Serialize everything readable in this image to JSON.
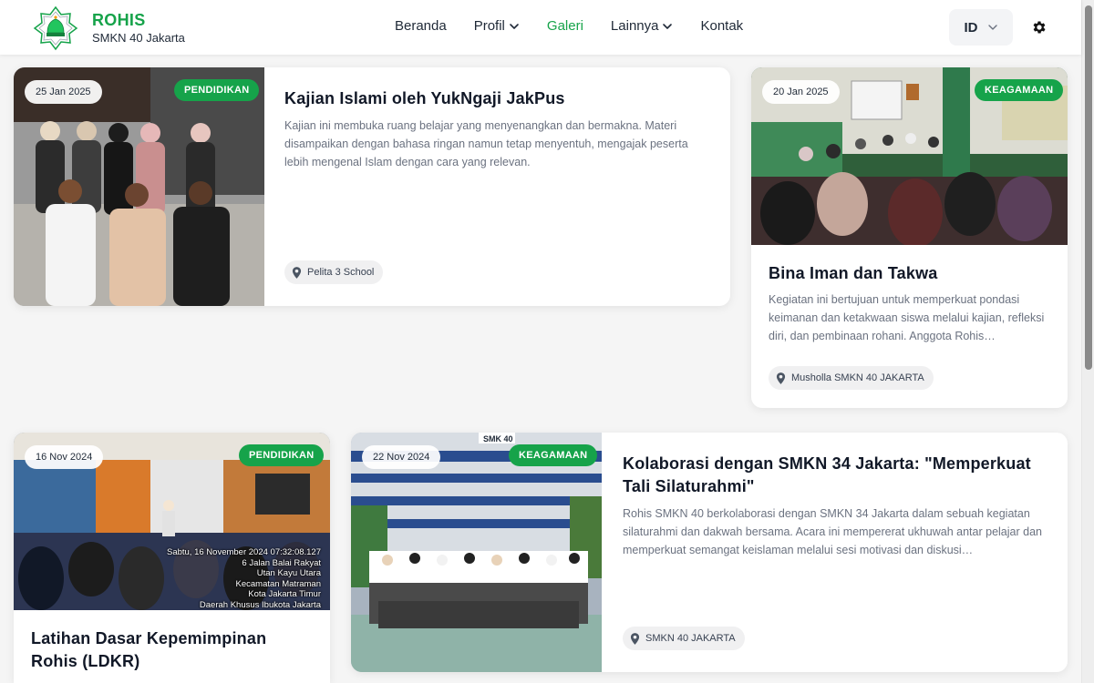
{
  "brand": {
    "title": "ROHIS",
    "subtitle": "SMKN 40 Jakarta"
  },
  "nav": {
    "beranda": "Beranda",
    "profil": "Profil",
    "galeri": "Galeri",
    "lainnya": "Lainnya",
    "kontak": "Kontak",
    "active": "Galeri"
  },
  "language": {
    "selected": "ID"
  },
  "colors": {
    "accent": "#16a34a",
    "background": "#f5f5f5"
  },
  "icons": [
    "chevron-down-icon",
    "gear-icon",
    "map-pin-icon"
  ],
  "gallery": [
    {
      "date": "25 Jan 2025",
      "category": "PENDIDIKAN",
      "title": "Kajian Islami oleh YukNgaji JakPus",
      "description": "Kajian ini membuka ruang belajar yang menyenangkan dan bermakna. Materi disampaikan dengan bahasa ringan namun tetap menyentuh, mengajak peserta lebih mengenal Islam dengan cara yang relevan.",
      "location": "Pelita 3 School"
    },
    {
      "date": "20 Jan 2025",
      "category": "KEAGAMAAN",
      "title": "Bina Iman dan Takwa",
      "description": "Kegiatan ini bertujuan untuk memperkuat pondasi keimanan dan ketakwaan siswa melalui kajian, refleksi diri, dan pembinaan rohani. Anggota Rohis…",
      "location": "Musholla SMKN 40 JAKARTA"
    },
    {
      "date": "16 Nov 2024",
      "category": "PENDIDIKAN",
      "title": "Latihan Dasar Kepemimpinan Rohis (LDKR)",
      "photo_stamp": [
        "Sabtu, 16 November 2024 07:32:08.127",
        "6 Jalan Balai Rakyat",
        "Utan Kayu Utara",
        "Kecamatan Matraman",
        "Kota Jakarta Timur",
        "Daerah Khusus Ibukota Jakarta"
      ]
    },
    {
      "date": "22 Nov 2024",
      "category": "KEAGAMAAN",
      "title": "Kolaborasi dengan SMKN 34 Jakarta: \"Memperkuat Tali Silaturahmi\"",
      "description": "Rohis SMKN 40 berkolaborasi dengan SMKN 34 Jakarta dalam sebuah kegiatan silaturahmi dan dakwah bersama. Acara ini mempererat ukhuwah antar pelajar dan memperkuat semangat keislaman melalui sesi motivasi dan diskusi…",
      "location": "SMKN 40 JAKARTA",
      "photo_sign": "SMK 40"
    }
  ]
}
